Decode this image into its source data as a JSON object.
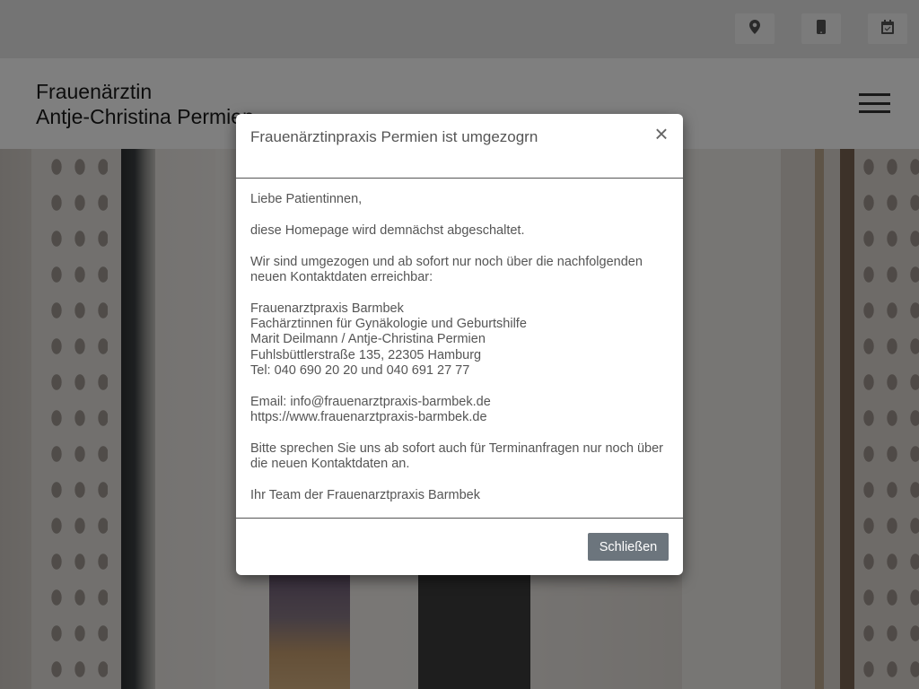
{
  "topbar": {
    "icons": [
      "location-pin-icon",
      "mobile-phone-icon",
      "calendar-icon"
    ]
  },
  "header": {
    "brand_line1": "Frauenärztin",
    "brand_line2": "Antje-Christina Permien",
    "menu_icon": "hamburger-menu-icon"
  },
  "modal": {
    "title": "Frauenärztinpraxis Permien ist umgezogrn",
    "close_icon": "close-icon",
    "body": {
      "greeting": "Liebe Patientinnen,",
      "p1": "diese Homepage wird demnächst abgeschaltet.",
      "p2": "Wir sind umgezogen und ab sofort nur noch über die nachfolgenden neuen Kontaktdaten erreichbar:",
      "address": {
        "line1": "Frauenarztpraxis Barmbek",
        "line2": "Fachärztinnen für Gynäkologie und Geburtshilfe",
        "line3": "Marit Deilmann / Antje-Christina Permien",
        "line4": "Fuhlsbüttlerstraße 135, 22305 Hamburg",
        "line5": "Tel: 040 690 20 20 und 040 691 27 77"
      },
      "email": "Email: info@frauenarztpraxis-barmbek.de",
      "website": "https://www.frauenarztpraxis-barmbek.de",
      "p3": "Bitte sprechen Sie uns ab sofort auch für Terminanfragen nur noch über die neuen Kontaktdaten an.",
      "signoff": "Ihr Team der Frauenarztpraxis Barmbek"
    },
    "close_button": "Schließen"
  },
  "colors": {
    "overlay": "rgba(0,0,0,0.5)",
    "button": "#6c757d",
    "text": "#555555"
  }
}
